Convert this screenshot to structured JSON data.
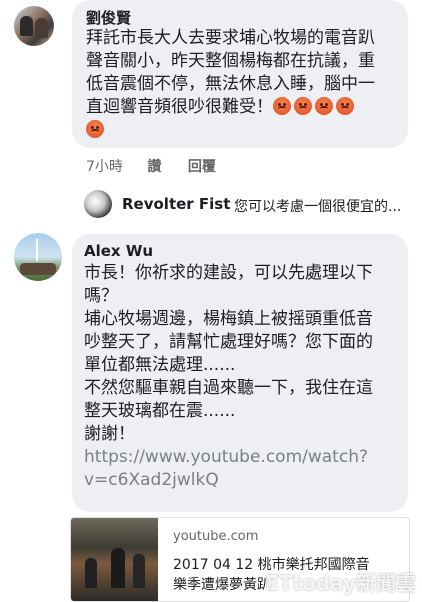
{
  "comment1": {
    "author": "劉俊賢",
    "lines": [
      "拜託市長大人去要求埔心牧場的電音趴",
      "聲音關小，昨天整個楊梅都在抗議，重",
      "低音震個不停，無法休息入睡，腦中一",
      "直迴響音頻很吵很難受！"
    ],
    "reaction_emoji_icon": "angry-face-icon",
    "time": "7小時",
    "like_label": "讚",
    "reply_label": "回覆"
  },
  "reply_preview": {
    "author": "Revolter Fist",
    "snippet": "您可以考慮一個很便宜的..."
  },
  "comment2": {
    "author": "Alex Wu",
    "lines": [
      "市長！你祈求的建設，可以先處理以下",
      "嗎？",
      "埔心牧場週邊，楊梅鎮上被摇頭重低音",
      "吵整天了，請幫忙處理好嗎？您下面的",
      "單位都無法處理......",
      "不然您驅車親自過來聽一下，我住在這",
      "整天玻璃都在震......",
      "謝謝！"
    ],
    "link_lines": [
      "https://www.youtube.com/watch?",
      "v=c6Xad2jwlkQ"
    ]
  },
  "link_preview": {
    "domain": "youtube.com",
    "title_lines": [
      "2017 04 12 桃市樂托邦國際音",
      "樂季遭爆夢黃趴"
    ]
  },
  "watermark": "ETtoday新聞雲",
  "colors": {
    "bubble": "#eeeff2",
    "meta_text": "#65676b",
    "link_text": "#7a7f86",
    "emoji": "#e4572e"
  }
}
